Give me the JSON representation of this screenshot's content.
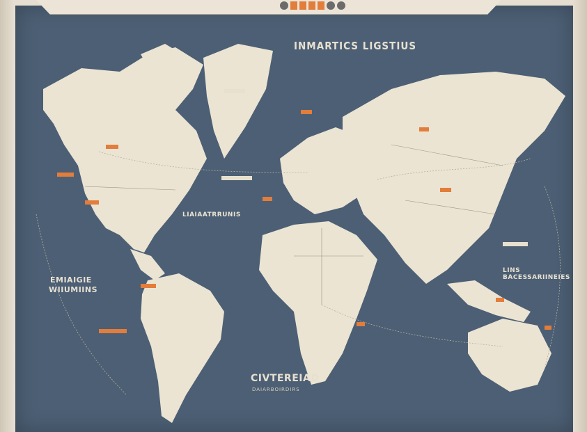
{
  "map": {
    "title": "INMARTICS LIGSTIUS",
    "bottom_label": "CIVTEREIAD",
    "bottom_sublabel": "DAIARBOIRDIRS",
    "left_label_1": "EMIAIGIE",
    "left_label_2": "WIIUMIINS",
    "east_label": "LINS BACESSARIINEIES",
    "center_label": "LIAIAATRRUNIS"
  },
  "colors": {
    "ocean": "#4c5f74",
    "land": "#ebe4d3",
    "accent": "#e27d3b",
    "frame": "#e6ded0"
  }
}
